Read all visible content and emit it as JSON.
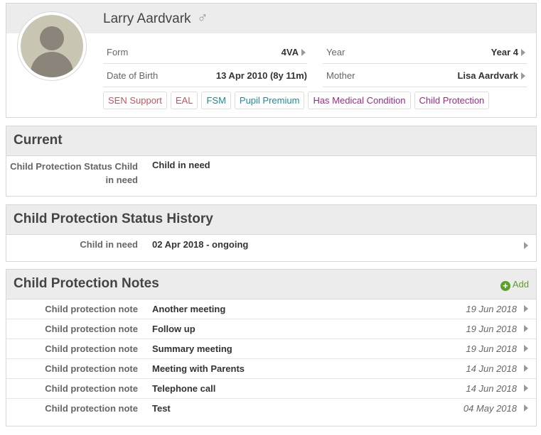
{
  "student": {
    "name": "Larry Aardvark",
    "gender_icon": "♂",
    "form_label": "Form",
    "form_value": "4VA",
    "year_label": "Year",
    "year_value": "Year 4",
    "dob_label": "Date of Birth",
    "dob_value": "13 Apr 2010 (8y 11m)",
    "mother_label": "Mother",
    "mother_value": "Lisa Aardvark"
  },
  "tags": [
    {
      "label": "SEN Support",
      "color": "#c8545e"
    },
    {
      "label": "EAL",
      "color": "#c8545e"
    },
    {
      "label": "FSM",
      "color": "#1f8a9a"
    },
    {
      "label": "Pupil Premium",
      "color": "#1f8a9a"
    },
    {
      "label": "Has Medical Condition",
      "color": "#9c2a8a"
    },
    {
      "label": "Child Protection",
      "color": "#9c2a8a"
    }
  ],
  "current": {
    "title": "Current",
    "key": "Child Protection Status Child in need",
    "value": "Child in need"
  },
  "history": {
    "title": "Child Protection Status History",
    "key": "Child in need",
    "value": "02 Apr 2018 - ongoing"
  },
  "notes": {
    "title": "Child Protection Notes",
    "add_label": "Add",
    "rows": [
      {
        "type": "Child protection note",
        "title": "Another meeting",
        "date": "19 Jun 2018"
      },
      {
        "type": "Child protection note",
        "title": "Follow up",
        "date": "19 Jun 2018"
      },
      {
        "type": "Child protection note",
        "title": "Summary meeting",
        "date": "19 Jun 2018"
      },
      {
        "type": "Child protection note",
        "title": "Meeting with Parents",
        "date": "14 Jun 2018"
      },
      {
        "type": "Child protection note",
        "title": "Telephone call",
        "date": "14 Jun 2018"
      },
      {
        "type": "Child protection note",
        "title": "Test",
        "date": "04 May 2018"
      }
    ]
  },
  "colors": {
    "accent_green": "#5aa02c",
    "header_bg": "#ececec"
  }
}
